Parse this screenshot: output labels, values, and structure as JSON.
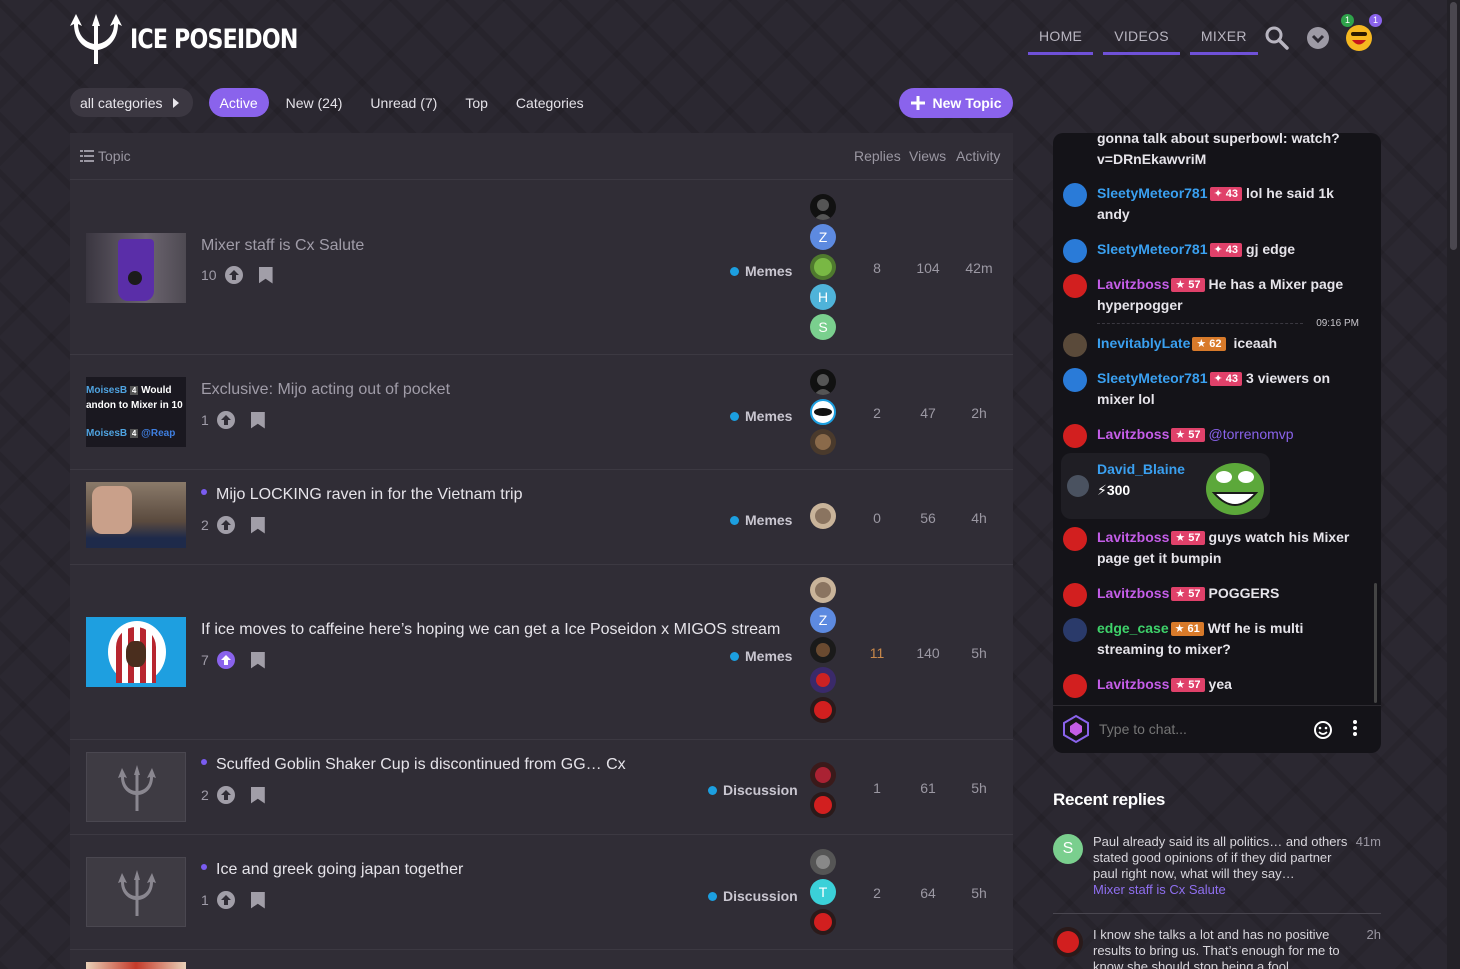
{
  "site": {
    "logo_text": "ICE POSEIDON"
  },
  "header": {
    "nav": [
      "HOME",
      "VIDEOS",
      "MIXER"
    ],
    "search_icon": "search-icon",
    "menu_icon": "chevron-down-icon",
    "badge_green": "1",
    "badge_purple": "1"
  },
  "nav": {
    "category_dropdown": "all categories",
    "tabs": [
      "Active",
      "New (24)",
      "Unread (7)",
      "Top",
      "Categories"
    ],
    "new_topic": "New Topic"
  },
  "list": {
    "headers": {
      "topic": "Topic",
      "replies": "Replies",
      "views": "Views",
      "activity": "Activity"
    },
    "topics": [
      {
        "title": "Mixer staff is Cx Salute",
        "likes": "10",
        "category": "Memes",
        "replies": "8",
        "views": "104",
        "activity": "42m"
      },
      {
        "title": "Exclusive: Mijo acting out of pocket",
        "likes": "1",
        "category": "Memes",
        "replies": "2",
        "views": "47",
        "activity": "2h",
        "thumb_lines": [
          "MoisesB",
          "Would",
          "andon to Mixer in 10",
          "MoisesB",
          "@Reap"
        ]
      },
      {
        "title": "Mijo LOCKING raven in for the Vietnam trip",
        "likes": "2",
        "category": "Memes",
        "replies": "0",
        "views": "56",
        "activity": "4h"
      },
      {
        "title": "If ice moves to caffeine here’s hoping we can get a Ice Poseidon x MIGOS stream",
        "likes": "7",
        "category": "Memes",
        "replies": "11",
        "views": "140",
        "activity": "5h"
      },
      {
        "title": "Scuffed Goblin Shaker Cup is discontinued from GG… Cx",
        "likes": "2",
        "category": "Discussion",
        "replies": "1",
        "views": "61",
        "activity": "5h"
      },
      {
        "title": "Ice and greek going japan together",
        "likes": "1",
        "category": "Discussion",
        "replies": "2",
        "views": "64",
        "activity": "5h"
      }
    ],
    "poster_letters": [
      "Z",
      "H",
      "S",
      "Z",
      "T"
    ]
  },
  "chat": {
    "messages": [
      {
        "user": "",
        "level": "",
        "text": "gonna talk about superbowl: watch? v=DRnEkawvriM"
      },
      {
        "user": "SleetyMeteor781",
        "level": "43",
        "text": "lol he said 1k andy"
      },
      {
        "user": "SleetyMeteor781",
        "level": "43",
        "text": "gj edge"
      },
      {
        "user": "Lavitzboss",
        "level": "57",
        "text": "He has a Mixer page hyperpogger"
      },
      {
        "user": "InevitablyLate",
        "level": "62",
        "text": "iceaah"
      },
      {
        "user": "SleetyMeteor781",
        "level": "43",
        "text": "3 viewers on mixer lol"
      },
      {
        "user": "Lavitzboss",
        "level": "57",
        "text": "@torrenomvp"
      },
      {
        "user": "Lavitzboss",
        "level": "57",
        "text": "guys watch his Mixer page get it bumpin"
      },
      {
        "user": "Lavitzboss",
        "level": "57",
        "text": "POGGERS"
      },
      {
        "user": "edge_case",
        "level": "61",
        "text": "Wtf he is multi streaming to mixer?"
      },
      {
        "user": "Lavitzboss",
        "level": "57",
        "text": "yea"
      }
    ],
    "timestamp": "09:16 PM",
    "sticker": {
      "user": "David_Blaine",
      "amount": "300"
    },
    "input_placeholder": "Type to chat..."
  },
  "recent_replies": {
    "title": "Recent replies",
    "items": [
      {
        "text": "Paul already said its all politics… and others stated good opinions of if they did partner paul right now, what will they say…",
        "topic": "Mixer staff is Cx Salute",
        "time": "41m",
        "avatar_letter": "S"
      },
      {
        "text": "I know she talks a lot and has no positive results to bring us. That’s enough for me to know she should stop being a fool",
        "time": "2h"
      }
    ]
  },
  "colors": {
    "accent": "#8a63ec",
    "memes": "#1c9fe0",
    "level_badge": "#e0416a",
    "level_badge_orange": "#d87a2a"
  }
}
